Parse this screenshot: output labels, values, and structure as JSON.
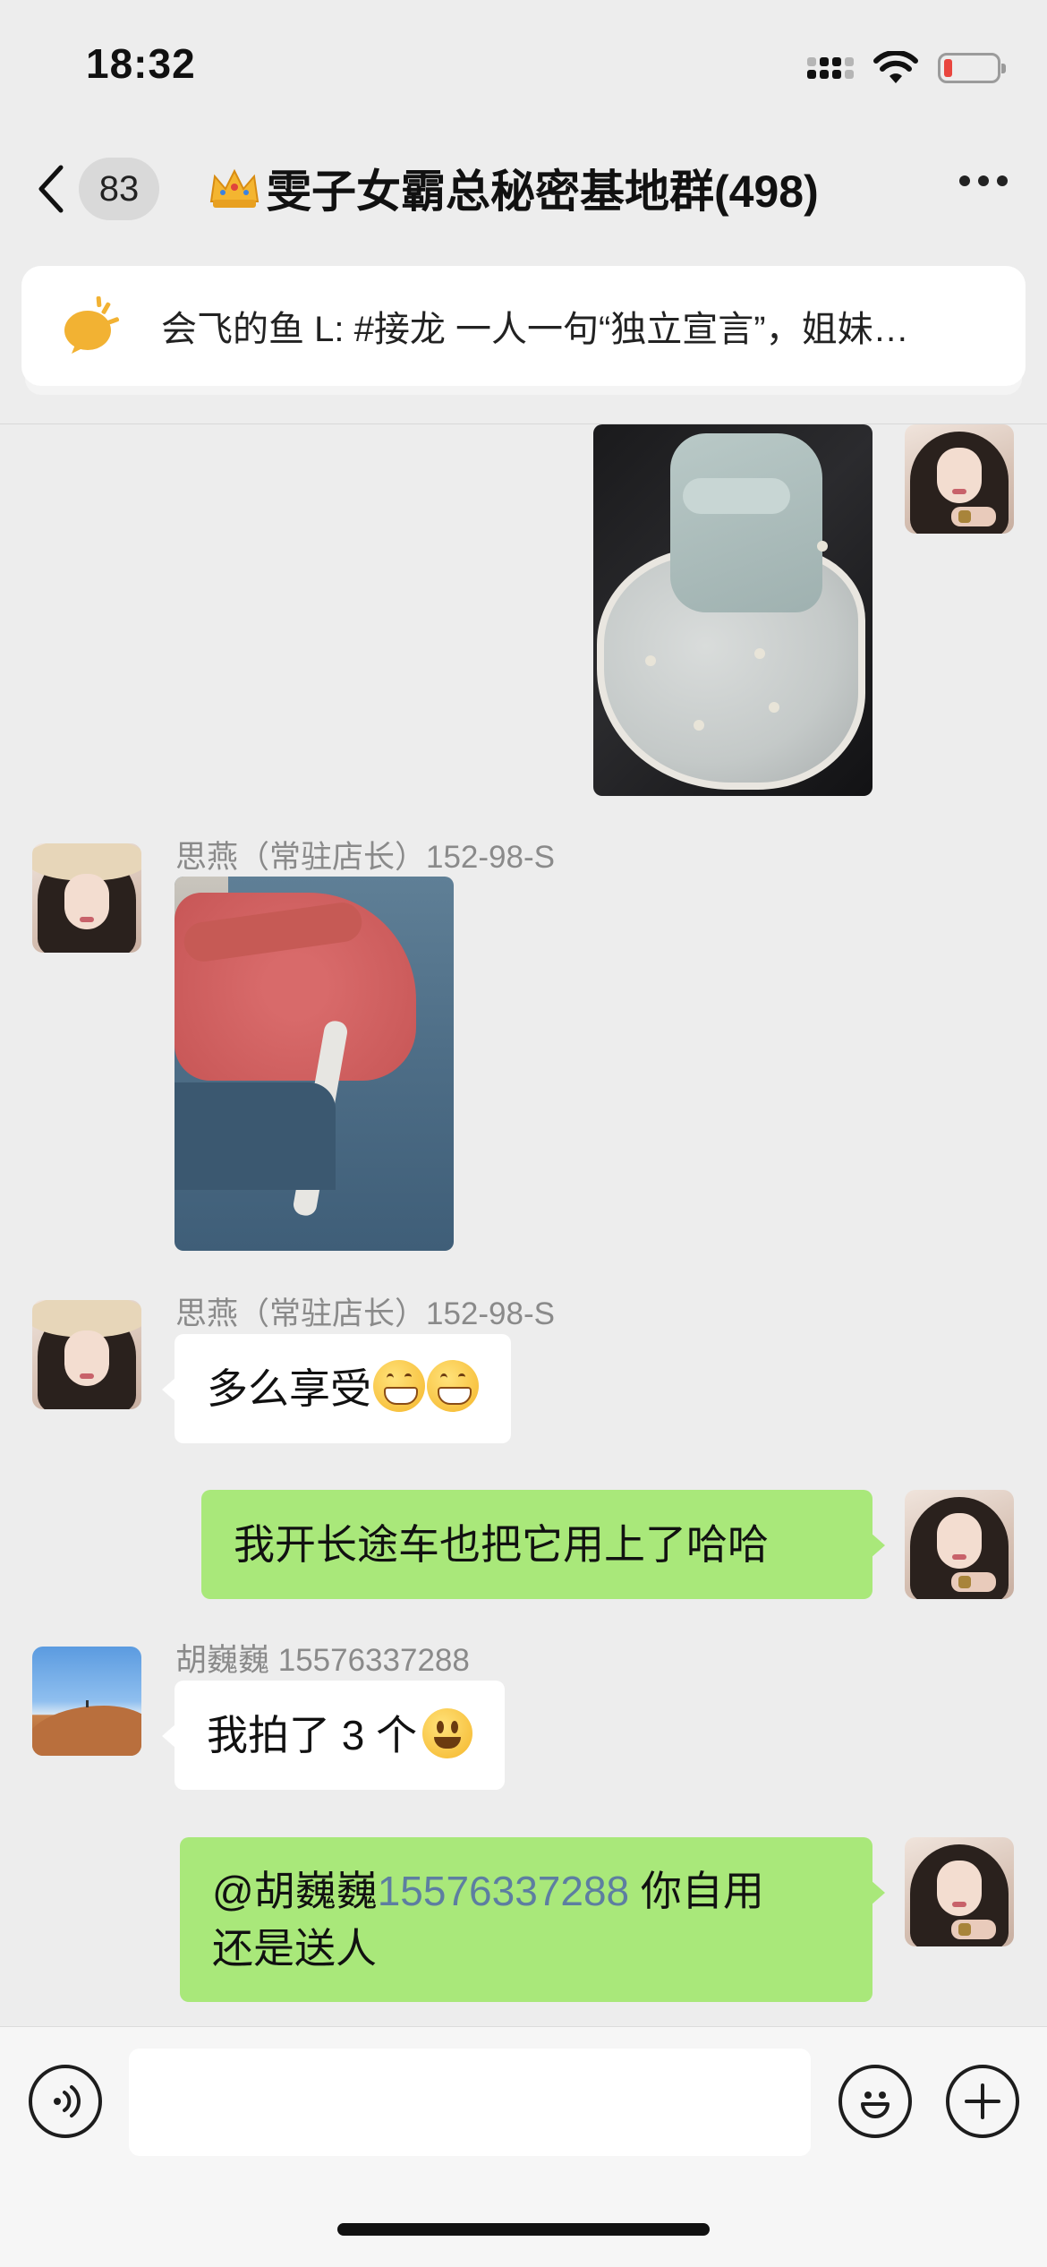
{
  "status_bar": {
    "time": "18:32"
  },
  "nav": {
    "unread_count": "83",
    "title": "雯子女霸总秘密基地群(498)"
  },
  "notice": {
    "text": "会飞的鱼 L: #接龙 一人一句“独立宣言”，姐妹…"
  },
  "messages": [
    {
      "side": "right",
      "type": "image",
      "description_icon": "seat-cushion-photo"
    },
    {
      "side": "left",
      "type": "image",
      "sender": "思燕（常驻店长）152-98-S"
    },
    {
      "side": "left",
      "type": "text",
      "sender": "思燕（常驻店长）152-98-S",
      "text": "多么享受",
      "emoji": [
        "grinning-face",
        "grinning-face"
      ]
    },
    {
      "side": "right",
      "type": "text",
      "text": "我开长途车也把它用上了哈哈"
    },
    {
      "side": "left",
      "type": "text",
      "sender": "胡巍巍 15576337288",
      "text": "我拍了 3 个",
      "emoji": [
        "smiling-face"
      ]
    },
    {
      "side": "right",
      "type": "text",
      "mention": "@胡巍巍",
      "mention_number": "15576337288",
      "text_line1_rest": " 你自用",
      "text_line2": "还是送人"
    }
  ],
  "colors": {
    "background": "#ededed",
    "outgoing_bubble": "#a9e87a",
    "incoming_bubble": "#ffffff",
    "mention": "#5d7ea1"
  }
}
